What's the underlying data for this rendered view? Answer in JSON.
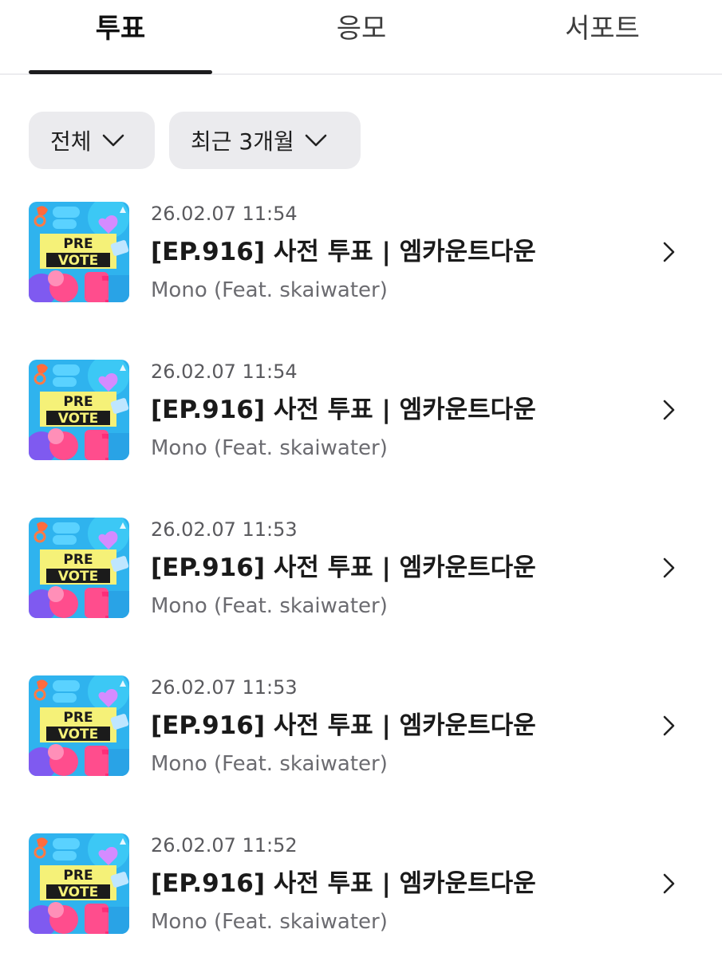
{
  "tabs": [
    {
      "label": "투표",
      "active": true
    },
    {
      "label": "응모",
      "active": false
    },
    {
      "label": "서포트",
      "active": false
    }
  ],
  "filters": [
    {
      "label": "전체"
    },
    {
      "label": "최근 3개월"
    }
  ],
  "thumbnail_text": {
    "line1": "PRE",
    "line2": "VOTE"
  },
  "items": [
    {
      "date": "26.02.07 11:54",
      "title": "[EP.916] 사전 투표 | 엠카운트다운",
      "subtitle": "Mono (Feat. skaiwater)"
    },
    {
      "date": "26.02.07 11:54",
      "title": "[EP.916] 사전 투표 | 엠카운트다운",
      "subtitle": "Mono (Feat. skaiwater)"
    },
    {
      "date": "26.02.07 11:53",
      "title": "[EP.916] 사전 투표 | 엠카운트다운",
      "subtitle": "Mono (Feat. skaiwater)"
    },
    {
      "date": "26.02.07 11:53",
      "title": "[EP.916] 사전 투표 | 엠카운트다운",
      "subtitle": "Mono (Feat. skaiwater)"
    },
    {
      "date": "26.02.07 11:52",
      "title": "[EP.916] 사전 투표 | 엠카운트다운",
      "subtitle": "Mono (Feat. skaiwater)"
    }
  ],
  "icons": {
    "filter_dropdown": "chevron-down-icon",
    "item_arrow": "chevron-right-icon"
  },
  "colors": {
    "tab_indicator": "#1c1c1e",
    "filter_bg": "#ebebee",
    "thumb_bg": "#2fb3ee",
    "thumb_banner": "#f5f178"
  }
}
